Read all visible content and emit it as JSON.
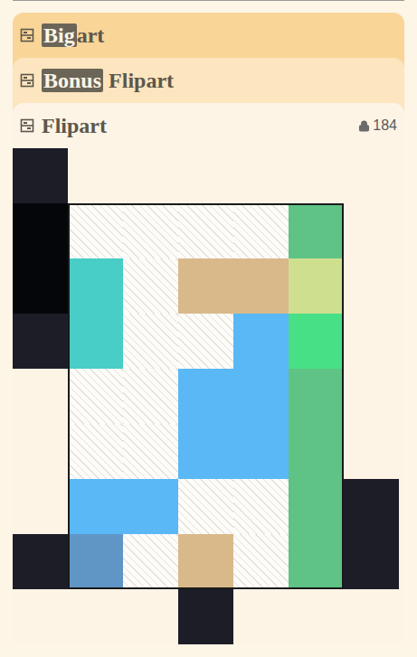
{
  "puzzle_list": [
    {
      "title_parts": [
        {
          "text": "Big",
          "highlighted": true
        },
        {
          "text": "art",
          "highlighted": false
        }
      ],
      "color": "#f9d598",
      "count": "",
      "locked": false
    },
    {
      "title_parts": [
        {
          "text": "Bonus",
          "highlighted": true
        },
        {
          "text": " Flipart",
          "highlighted": false
        }
      ],
      "color": "#fde5bf",
      "count": "",
      "locked": false
    },
    {
      "title_parts": [
        {
          "text": "Flipart",
          "highlighted": false
        }
      ],
      "color": "#fdf4e6",
      "count": "184",
      "locked": true
    }
  ],
  "canvas": {
    "rows": [
      [
        {
          "kind": "tile",
          "color": "#1c1d27"
        },
        {
          "kind": "empty"
        },
        {
          "kind": "empty"
        },
        {
          "kind": "empty"
        },
        {
          "kind": "empty"
        },
        {
          "kind": "empty"
        },
        {
          "kind": "empty"
        }
      ],
      [
        {
          "kind": "tile",
          "color": "#05060a"
        },
        {
          "kind": "blank"
        },
        {
          "kind": "blank"
        },
        {
          "kind": "blank"
        },
        {
          "kind": "blank"
        },
        {
          "kind": "tile",
          "color": "#5ec384"
        },
        {
          "kind": "empty"
        }
      ],
      [
        {
          "kind": "tile",
          "color": "#05060a"
        },
        {
          "kind": "tile",
          "color": "#48cdc7"
        },
        {
          "kind": "blank"
        },
        {
          "kind": "tile",
          "color": "#d9b98a"
        },
        {
          "kind": "tile",
          "color": "#d9b98a"
        },
        {
          "kind": "tile",
          "color": "#cfdf90"
        },
        {
          "kind": "empty"
        }
      ],
      [
        {
          "kind": "tile",
          "color": "#1c1d27"
        },
        {
          "kind": "tile",
          "color": "#48cdc7"
        },
        {
          "kind": "blank"
        },
        {
          "kind": "blank"
        },
        {
          "kind": "tile",
          "color": "#5ab8f6"
        },
        {
          "kind": "tile",
          "color": "#48e086"
        },
        {
          "kind": "empty"
        }
      ],
      [
        {
          "kind": "empty"
        },
        {
          "kind": "blank"
        },
        {
          "kind": "blank"
        },
        {
          "kind": "tile",
          "color": "#5ab8f6"
        },
        {
          "kind": "tile",
          "color": "#5ab8f6"
        },
        {
          "kind": "tile",
          "color": "#5ec384"
        },
        {
          "kind": "empty"
        }
      ],
      [
        {
          "kind": "empty"
        },
        {
          "kind": "blank"
        },
        {
          "kind": "blank"
        },
        {
          "kind": "tile",
          "color": "#5ab8f6"
        },
        {
          "kind": "tile",
          "color": "#5ab8f6"
        },
        {
          "kind": "tile",
          "color": "#5ec384"
        },
        {
          "kind": "empty"
        }
      ],
      [
        {
          "kind": "empty"
        },
        {
          "kind": "tile",
          "color": "#5ab8f6"
        },
        {
          "kind": "tile",
          "color": "#5ab8f6"
        },
        {
          "kind": "blank"
        },
        {
          "kind": "blank"
        },
        {
          "kind": "tile",
          "color": "#5ec384"
        },
        {
          "kind": "tile",
          "color": "#1c1d27"
        }
      ],
      [
        {
          "kind": "tile",
          "color": "#1c1d27"
        },
        {
          "kind": "tile",
          "color": "#6096c6"
        },
        {
          "kind": "blank"
        },
        {
          "kind": "tile",
          "color": "#d9b98a"
        },
        {
          "kind": "blank"
        },
        {
          "kind": "tile",
          "color": "#5ec384"
        },
        {
          "kind": "tile",
          "color": "#1c1d27"
        }
      ],
      [
        {
          "kind": "empty"
        },
        {
          "kind": "empty"
        },
        {
          "kind": "empty"
        },
        {
          "kind": "tile",
          "color": "#1c1d27"
        },
        {
          "kind": "empty"
        },
        {
          "kind": "empty"
        },
        {
          "kind": "empty"
        }
      ]
    ]
  }
}
